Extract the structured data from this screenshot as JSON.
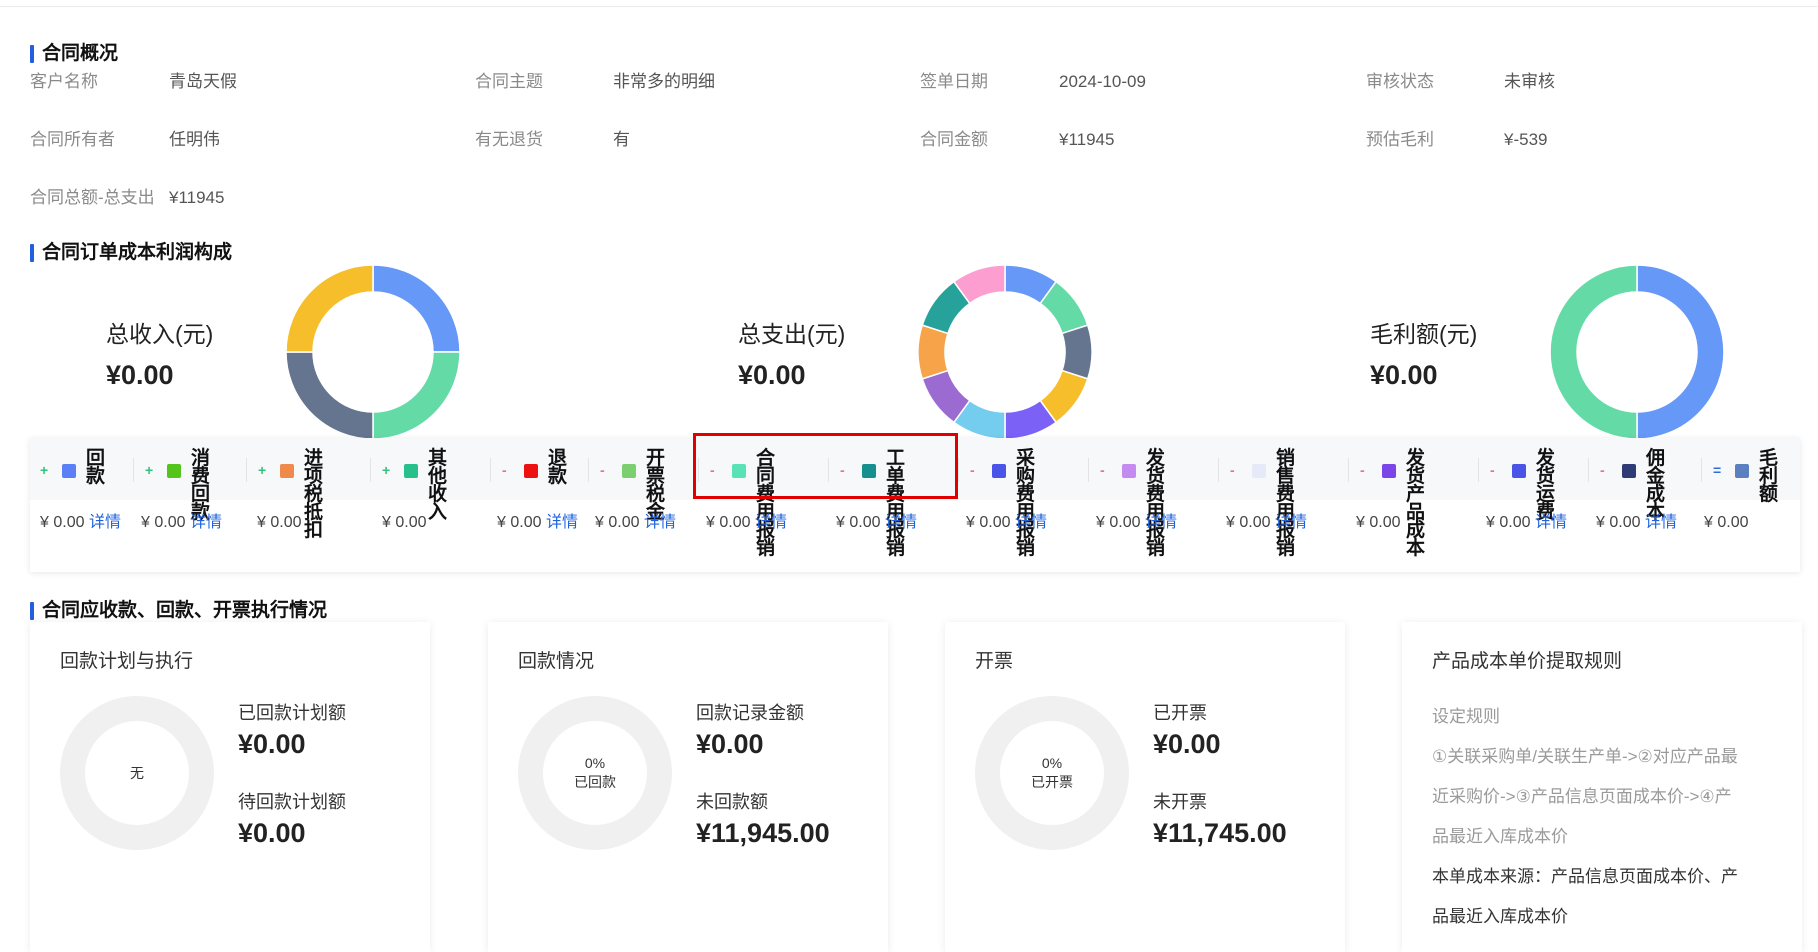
{
  "sections": {
    "overview": "合同概况",
    "composition": "合同订单成本利润构成",
    "execution": "合同应收款、回款、开票执行情况"
  },
  "overview": {
    "customer_label": "客户名称",
    "customer": "青岛天假",
    "subject_label": "合同主题",
    "subject": "非常多的明细",
    "sign_date_label": "签单日期",
    "sign_date": "2024-10-09",
    "audit_label": "审核状态",
    "audit": "未审核",
    "owner_label": "合同所有者",
    "owner": "任明伟",
    "return_label": "有无退货",
    "return": "有",
    "amount_label": "合同金额",
    "amount": "¥11945",
    "profit_label": "预估毛利",
    "profit": "¥-539",
    "net_label": "合同总额-总支出",
    "net": "¥11945"
  },
  "metrics": {
    "income": {
      "label": "总收入(元)",
      "value": "¥0.00"
    },
    "expense": {
      "label": "总支出(元)",
      "value": "¥0.00"
    },
    "profit": {
      "label": "毛利额(元)",
      "value": "¥0.00"
    }
  },
  "donut_colors": {
    "income": [
      "#6699f7",
      "#64dba7",
      "#65748f",
      "#f6be2a"
    ],
    "expense": [
      "#6699f7",
      "#64dba7",
      "#65748f",
      "#f6be2a",
      "#7b61f5",
      "#74cdef",
      "#9c6bd1",
      "#f6a34a",
      "#27a29b",
      "#fc9ed0"
    ],
    "profit": [
      "#6699f7",
      "#64dba7"
    ]
  },
  "cost_items": [
    {
      "sign": "+",
      "color": "#5b7ff5",
      "l1": "回",
      "l2": "款",
      "value": "¥ 0.00",
      "detail": "详情"
    },
    {
      "sign": "+",
      "color": "#52c41a",
      "l1": "消费",
      "l2": "回款",
      "value": "¥ 0.00",
      "detail": "详情"
    },
    {
      "sign": "+",
      "color": "#f08a4b",
      "l1": "进项税",
      "l2": "抵扣",
      "value": "¥ 0.00",
      "detail": ""
    },
    {
      "sign": "+",
      "color": "#27c08a",
      "l1": "其他",
      "l2": "收入",
      "value": "¥ 0.00",
      "detail": ""
    },
    {
      "sign": "-",
      "color": "#ee1111",
      "l1": "退",
      "l2": "款",
      "value": "¥ 0.00",
      "detail": "详情"
    },
    {
      "sign": "-",
      "color": "#7ccf6f",
      "l1": "开票",
      "l2": "税金",
      "value": "¥ 0.00",
      "detail": "详情"
    },
    {
      "sign": "-",
      "color": "#59e3b4",
      "l1": "合同费",
      "l2": "用报销",
      "value": "¥ 0.00",
      "detail": "详情"
    },
    {
      "sign": "-",
      "color": "#168f8f",
      "l1": "工单费",
      "l2": "用报销",
      "value": "¥ 0.00",
      "detail": "详情"
    },
    {
      "sign": "-",
      "color": "#4a55e8",
      "l1": "采购费",
      "l2": "用报销",
      "value": "¥ 0.00",
      "detail": "详情"
    },
    {
      "sign": "-",
      "color": "#c48cf0",
      "l1": "发货费",
      "l2": "用报销",
      "value": "¥ 0.00",
      "detail": "详情"
    },
    {
      "sign": "-",
      "color": "#e6e9f7",
      "l1": "销售费",
      "l2": "用报销",
      "value": "¥ 0.00",
      "detail": "详情"
    },
    {
      "sign": "-",
      "color": "#7b45e8",
      "l1": "发货产",
      "l2": "品成本",
      "value": "¥ 0.00",
      "detail": ""
    },
    {
      "sign": "-",
      "color": "#4a55e8",
      "l1": "发货",
      "l2": "运费",
      "value": "¥ 0.00",
      "detail": "详情"
    },
    {
      "sign": "-",
      "color": "#2f3b74",
      "l1": "佣金",
      "l2": "成本",
      "value": "¥ 0.00",
      "detail": "详情"
    },
    {
      "sign": "=",
      "color": "#5b7fbf",
      "l1": "毛利",
      "l2": "额",
      "value": "¥ 0.00",
      "detail": ""
    }
  ],
  "cards": {
    "plan": {
      "title": "回款计划与执行",
      "ring": "无",
      "l1": "已回款计划额",
      "v1": "¥0.00",
      "l2": "待回款计划额",
      "v2": "¥0.00"
    },
    "payment": {
      "title": "回款情况",
      "ring_pct": "0%",
      "ring_label": "已回款",
      "l1": "回款记录金额",
      "v1": "¥0.00",
      "l2": "未回款额",
      "v2": "¥11,945.00"
    },
    "invoice": {
      "title": "开票",
      "ring_pct": "0%",
      "ring_label": "已开票",
      "l1": "已开票",
      "v1": "¥0.00",
      "l2": "未开票",
      "v2": "¥11,745.00"
    },
    "rule": {
      "title": "产品成本单价提取规则",
      "subtitle": "设定规则",
      "lines": [
        "①关联采购单/关联生产单->②对应产品最",
        "近采购价->③产品信息页面成本价->④产",
        "品最近入库成本价"
      ],
      "source_lines": [
        "本单成本来源：产品信息页面成本价、产",
        "品最近入库成本价"
      ]
    }
  }
}
